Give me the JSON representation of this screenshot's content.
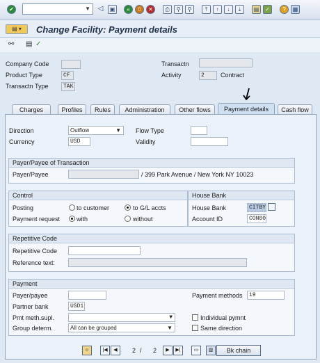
{
  "toolbar": {
    "command_field": "",
    "icons": [
      "enter-icon",
      "back-icon",
      "save-icon",
      "exit-icon",
      "cancel-icon",
      "print-icon",
      "find-icon",
      "find-next-icon",
      "first-page-icon",
      "prev-page-icon",
      "next-page-icon",
      "last-page-icon",
      "new-session-icon",
      "shortcut-icon",
      "help-icon",
      "layout-icon"
    ]
  },
  "title": "Change Facility: Payment details",
  "header": {
    "company_code_label": "Company Code",
    "company_code": "",
    "product_type_label": "Product Type",
    "product_type": "CF",
    "transactn_type_label": "Transactn Type",
    "transactn_type": "TAK",
    "transactn_label": "Transactn",
    "transactn": "",
    "activity_label": "Activity",
    "activity": "2",
    "activity_text": "Contract"
  },
  "tabs": [
    "Charges",
    "Profiles",
    "Rules",
    "Administration",
    "Other flows",
    "Payment details",
    "Cash flow"
  ],
  "active_tab": "Payment details",
  "direction": {
    "direction_label": "Direction",
    "direction_value": "Outflow",
    "currency_label": "Currency",
    "currency_value": "USD",
    "flow_type_label": "Flow Type",
    "flow_type_value": "",
    "validity_label": "Validity",
    "validity_value": ""
  },
  "payer_group": {
    "title": "Payer/Payee of Transaction",
    "payer_label": "Payer/Payee",
    "payer_value": "",
    "address": "/ 399 Park Avenue / New York NY 10023"
  },
  "control": {
    "title": "Control",
    "posting_label": "Posting",
    "to_customer": "to customer",
    "to_gl": "to G/L accts",
    "payment_request_label": "Payment request",
    "with": "with",
    "without": "without"
  },
  "house_bank": {
    "title": "House Bank",
    "house_bank_label": "House Bank",
    "house_bank_value": "CITBY",
    "account_id_label": "Account ID",
    "account_id_value": "CON00"
  },
  "repetitive": {
    "title": "Repetitive Code",
    "code_label": "Repetitive Code",
    "code_value": "",
    "reference_label": "Reference text:",
    "reference_value": ""
  },
  "payment": {
    "title": "Payment",
    "payer_label": "Payer/payee",
    "payer_value": "",
    "partner_bank_label": "Partner bank",
    "partner_bank_value": "USD1",
    "pmt_meth_label": "Pmt meth.supl.",
    "pmt_meth_value": "",
    "group_label": "Group determ.",
    "group_value": "All can be grouped",
    "payment_methods_label": "Payment methods",
    "payment_methods_value": "19",
    "individual_label": "Individual pymnt",
    "same_direction_label": "Same direction"
  },
  "nav": {
    "current": "2",
    "separator": "/",
    "total": "2",
    "bk_chain": "Bk chain"
  }
}
